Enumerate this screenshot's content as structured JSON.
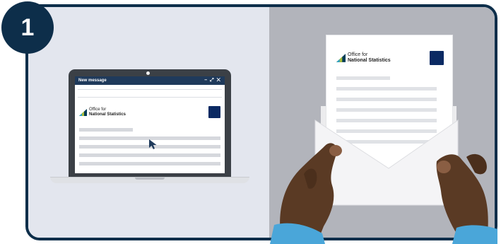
{
  "step": {
    "number": "1"
  },
  "email_window": {
    "title": "New message",
    "controls": "– ⤢ ✕"
  },
  "logo": {
    "line1": "Office for",
    "line2": "National Statistics"
  },
  "colors": {
    "navy": "#0d2e4a",
    "left_bg": "#e3e6ee",
    "right_bg": "#b2b4bb",
    "sleeve": "#4aa6d9",
    "skin": "#5a3a24"
  },
  "icons": [
    "step-number-badge",
    "laptop-icon",
    "mouse-cursor-icon",
    "ons-logo-icon",
    "royal-crest-icon",
    "letter-icon",
    "envelope-icon",
    "hand-icon"
  ]
}
